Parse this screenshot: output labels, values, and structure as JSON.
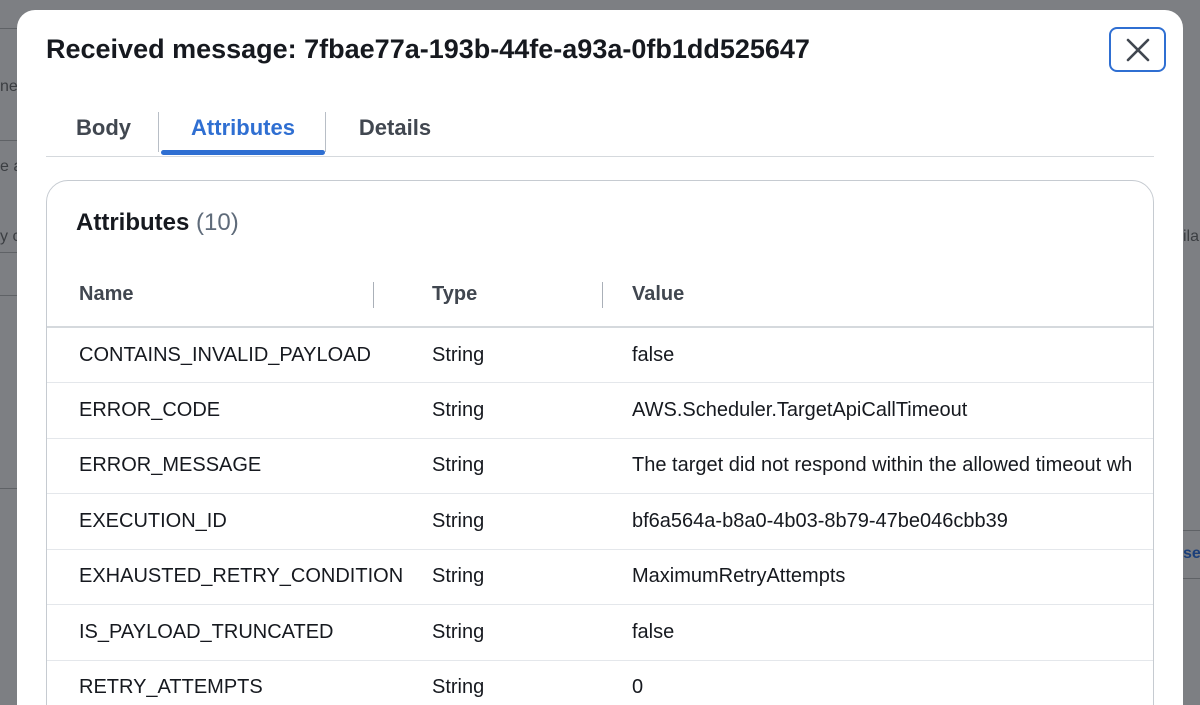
{
  "background": {
    "frag1": "nes",
    "frag2": "e a",
    "frag3": "y c",
    "frag4": "ila",
    "frag5": "se"
  },
  "modal": {
    "title": "Received message: 7fbae77a-193b-44fe-a93a-0fb1dd525647",
    "close_icon": "close-icon"
  },
  "tabs": [
    {
      "label": "Body",
      "active": false
    },
    {
      "label": "Attributes",
      "active": true
    },
    {
      "label": "Details",
      "active": false
    }
  ],
  "attributes": {
    "heading": "Attributes",
    "count": "(10)",
    "columns": [
      "Name",
      "Type",
      "Value"
    ],
    "rows": [
      {
        "name": "CONTAINS_INVALID_PAYLOAD",
        "type": "String",
        "value": "false"
      },
      {
        "name": "ERROR_CODE",
        "type": "String",
        "value": "AWS.Scheduler.TargetApiCallTimeout"
      },
      {
        "name": "ERROR_MESSAGE",
        "type": "String",
        "value": "The target did not respond within the allowed timeout wh"
      },
      {
        "name": "EXECUTION_ID",
        "type": "String",
        "value": "bf6a564a-b8a0-4b03-8b79-47be046cbb39"
      },
      {
        "name": "EXHAUSTED_RETRY_CONDITION",
        "type": "String",
        "value": "MaximumRetryAttempts"
      },
      {
        "name": "IS_PAYLOAD_TRUNCATED",
        "type": "String",
        "value": "false"
      },
      {
        "name": "RETRY_ATTEMPTS",
        "type": "String",
        "value": "0"
      }
    ]
  },
  "colors": {
    "accent": "#2f6fd2",
    "overlay": "#7d7f83"
  }
}
